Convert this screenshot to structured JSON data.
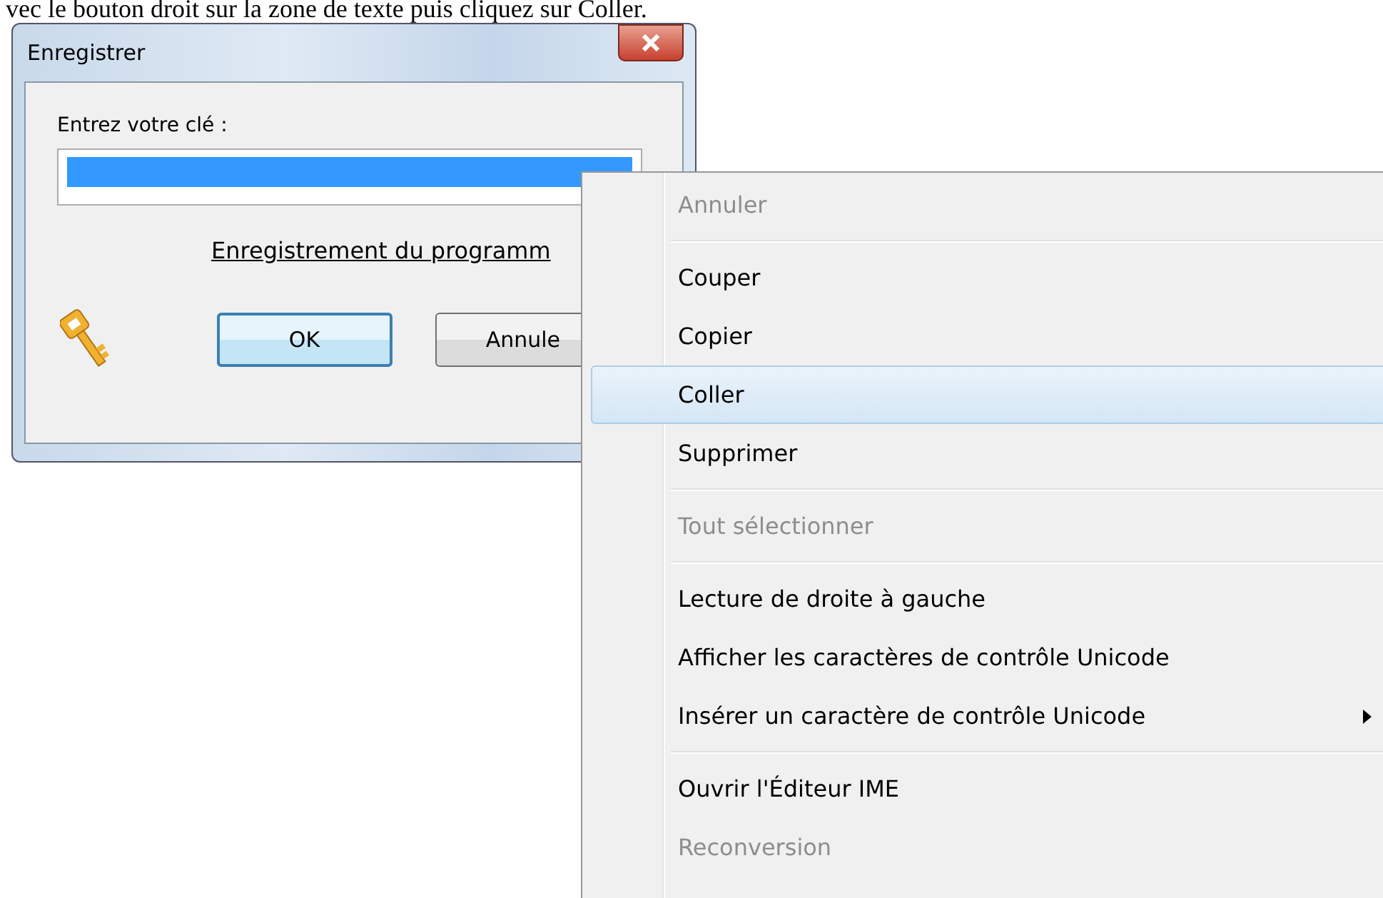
{
  "instruction": "vec le bouton droit sur la zone de texte puis cliquez sur Coller.",
  "dialog": {
    "title": "Enregistrer",
    "label": "Entrez votre clé :",
    "key_field": {
      "text_selected": true
    },
    "link": "Enregistrement du programm",
    "buttons": [
      {
        "label": "OK",
        "default": true
      },
      {
        "label": "Annule",
        "default": false
      }
    ]
  },
  "context_menu": [
    {
      "kind": "item",
      "label": "Annuler",
      "disabled": true,
      "selected": false
    },
    {
      "kind": "separator"
    },
    {
      "kind": "item",
      "label": "Couper",
      "disabled": false,
      "selected": false
    },
    {
      "kind": "item",
      "label": "Copier",
      "disabled": false,
      "selected": false
    },
    {
      "kind": "item",
      "label": "Coller",
      "disabled": false,
      "selected": true
    },
    {
      "kind": "item",
      "label": "Supprimer",
      "disabled": false,
      "selected": false
    },
    {
      "kind": "separator"
    },
    {
      "kind": "item",
      "label": "Tout sélectionner",
      "disabled": true,
      "selected": false
    },
    {
      "kind": "separator"
    },
    {
      "kind": "item",
      "label": "Lecture de droite à gauche",
      "disabled": false,
      "selected": false
    },
    {
      "kind": "item",
      "label": "Afficher les caractères de contrôle Unicode",
      "disabled": false,
      "selected": false
    },
    {
      "kind": "submenu",
      "label": "Insérer un caractère de contrôle Unicode",
      "disabled": false,
      "selected": false
    },
    {
      "kind": "separator"
    },
    {
      "kind": "item",
      "label": "Ouvrir l'Éditeur IME",
      "disabled": false,
      "selected": false
    },
    {
      "kind": "item",
      "label": "Reconversion",
      "disabled": true,
      "selected": false
    }
  ]
}
